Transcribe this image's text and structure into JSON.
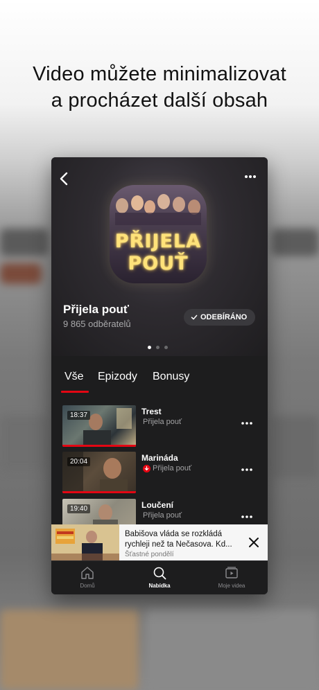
{
  "headline": {
    "line1": "Video můžete minimalizovat",
    "line2": "a procházet další obsah"
  },
  "show": {
    "poster_line1": "PŘIJELA",
    "poster_line2": "POUŤ",
    "title": "Přijela pouť",
    "subscribers": "9 865 odběratelů",
    "subscribe_button": "ODEBÍRÁNO",
    "carousel_pages": 3,
    "carousel_active": 1
  },
  "tabs": [
    {
      "label": "Vše",
      "active": true
    },
    {
      "label": "Epizody",
      "active": false
    },
    {
      "label": "Bonusy",
      "active": false
    }
  ],
  "episodes": [
    {
      "title": "Trest",
      "show": "Přijela pouť",
      "duration": "18:37",
      "downloaded": false,
      "progress": 1.0
    },
    {
      "title": "Marináda",
      "show": "Přijela pouť",
      "duration": "20:04",
      "downloaded": true,
      "progress": 1.0
    },
    {
      "title": "Loučení",
      "show": "Přijela pouť",
      "duration": "19:40",
      "downloaded": false,
      "progress": 0
    }
  ],
  "miniplayer": {
    "title": "Babišova vláda se rozkládá rychleji než ta Nečasova. Kd...",
    "subtitle": "Šťastné pondělí"
  },
  "tabbar": [
    {
      "label": "Domů",
      "icon": "home-icon",
      "active": false
    },
    {
      "label": "Nabídka",
      "icon": "search-icon",
      "active": true
    },
    {
      "label": "Moje videa",
      "icon": "my-videos-icon",
      "active": false
    }
  ],
  "colors": {
    "accent": "#e30613",
    "surface": "#1d1d1e"
  }
}
